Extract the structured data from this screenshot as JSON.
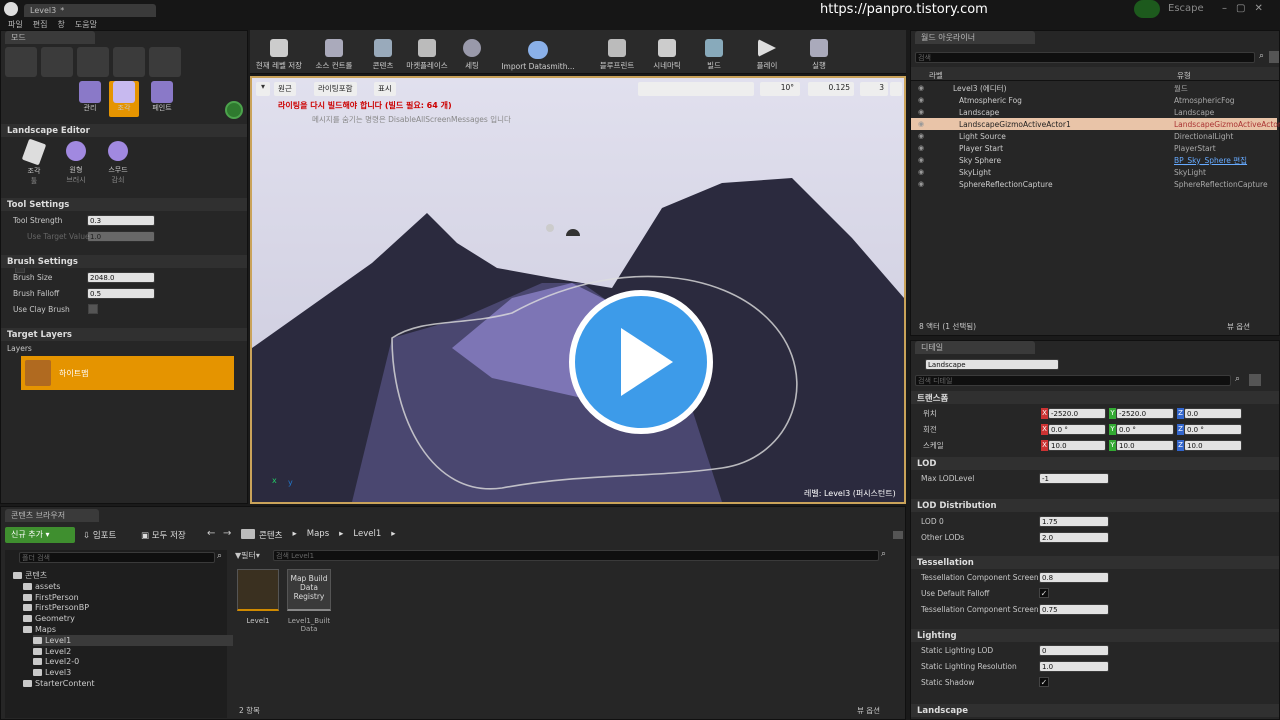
{
  "window": {
    "tab_title": "Level3",
    "watermark_url": "https://panpro.tistory.com",
    "escape_label": "Escape"
  },
  "menu": [
    "파일",
    "편집",
    "창",
    "도움말"
  ],
  "modes": {
    "tab": "모드",
    "tools": [
      "관리",
      "조각",
      "페인트"
    ],
    "active_tool": "조각"
  },
  "landscape_editor": {
    "title": "Landscape Editor",
    "brush_tools": [
      {
        "label": "조각",
        "sub": "툴"
      },
      {
        "label": "원형",
        "sub": "브러시"
      },
      {
        "label": "스무드",
        "sub": "감쇠"
      }
    ]
  },
  "tool_settings": {
    "title": "Tool Settings",
    "strength_label": "Tool Strength",
    "strength_value": "0.3",
    "target_label": "Use Target Value",
    "target_value": "1.0"
  },
  "brush_settings": {
    "title": "Brush Settings",
    "size_label": "Brush Size",
    "size_value": "2048.0",
    "falloff_label": "Brush Falloff",
    "falloff_value": "0.5",
    "clay_label": "Use Clay Brush"
  },
  "target_layers": {
    "title": "Target Layers",
    "layers_label": "Layers",
    "layer_name": "하이트맵"
  },
  "toolbar": [
    "현재 레벨 저장",
    "소스 컨트롤",
    "콘텐츠",
    "마켓플레이스",
    "세팅",
    "Import Datasmith...",
    "블루프린트",
    "시네마틱",
    "빌드",
    "플레이",
    "실행"
  ],
  "viewport": {
    "view_mode": "원근",
    "lighting": "라이팅포함",
    "show": "표시",
    "warning": "라이팅을 다시 빌드해야 합니다 (빌드 필요: 64 개)",
    "subwarning": "메시지를 숨기는 명령은 DisableAllScreenMessages 입니다",
    "angle": "10°",
    "scale": "0.125",
    "cams": "3",
    "level_label": "레벨:  Level3 (퍼시스턴트)",
    "axis_x": "x",
    "axis_y": "y"
  },
  "outliner": {
    "tab": "월드 아웃라이너",
    "search": "검색",
    "col_label": "라벨",
    "col_type": "유형",
    "count": "8 액터 (1 선택됨)",
    "view_options": "뷰 옵션",
    "rows": [
      {
        "name": "Level3 (에디터)",
        "type": "월드"
      },
      {
        "name": "Atmospheric Fog",
        "type": "AtmosphericFog"
      },
      {
        "name": "Landscape",
        "type": "Landscape"
      },
      {
        "name": "LandscapeGizmoActiveActor1",
        "type": "LandscapeGizmoActiveActor"
      },
      {
        "name": "Light Source",
        "type": "DirectionalLight"
      },
      {
        "name": "Player Start",
        "type": "PlayerStart"
      },
      {
        "name": "Sky Sphere",
        "type": "BP_Sky_Sphere 편집"
      },
      {
        "name": "SkyLight",
        "type": "SkyLight"
      },
      {
        "name": "SphereReflectionCapture",
        "type": "SphereReflectionCapture"
      }
    ]
  },
  "details": {
    "tab": "디테일",
    "object": "Landscape",
    "search": "검색 디테일",
    "transform": {
      "title": "트랜스폼",
      "loc_label": "위치",
      "rot_label": "회전",
      "scale_label": "스케일",
      "loc": [
        "-2520.0",
        "-2520.0",
        "0.0"
      ],
      "rot": [
        "0.0 °",
        "0.0 °",
        "0.0 °"
      ],
      "scale": [
        "10.0",
        "10.0",
        "10.0"
      ]
    },
    "lod": {
      "title": "LOD",
      "max_label": "Max LODLevel",
      "max_value": "-1"
    },
    "lod_dist": {
      "title": "LOD Distribution",
      "lod0_label": "LOD 0",
      "lod0_value": "1.75",
      "other_label": "Other LODs",
      "other_value": "2.0"
    },
    "tess": {
      "title": "Tessellation",
      "r1_label": "Tessellation Component Screen S",
      "r1_value": "0.8",
      "r2_label": "Use Default Falloff",
      "r3_label": "Tessellation Component Screen S",
      "r3_value": "0.75"
    },
    "lighting": {
      "title": "Lighting",
      "r1_label": "Static Lighting LOD",
      "r1_value": "0",
      "r2_label": "Static Lighting Resolution",
      "r2_value": "1.0",
      "r3_label": "Static Shadow"
    },
    "landscape_section": "Landscape"
  },
  "content_browser": {
    "tab": "콘텐츠 브라우저",
    "add_new": "신규 추가",
    "import": "임포트",
    "save_all": "모두 저장",
    "path": [
      "콘텐츠",
      "Maps",
      "Level1"
    ],
    "search_folders": "폴더 검색",
    "filter": "필터",
    "search_assets": "검색 Level1",
    "folders": [
      {
        "name": "콘텐츠",
        "level": 0
      },
      {
        "name": "assets",
        "level": 1
      },
      {
        "name": "FirstPerson",
        "level": 1
      },
      {
        "name": "FirstPersonBP",
        "level": 1
      },
      {
        "name": "Geometry",
        "level": 1
      },
      {
        "name": "Maps",
        "level": 1
      },
      {
        "name": "Level1",
        "level": 2
      },
      {
        "name": "Level2",
        "level": 2
      },
      {
        "name": "Level2-0",
        "level": 2
      },
      {
        "name": "Level3",
        "level": 2
      },
      {
        "name": "StarterContent",
        "level": 1
      }
    ],
    "assets": [
      {
        "thumb": "",
        "name": "Level1"
      },
      {
        "thumb": "Map Build Data Registry",
        "name": "Level1_Built Data"
      }
    ],
    "count": "2 항목",
    "view_options": "뷰 옵션"
  }
}
